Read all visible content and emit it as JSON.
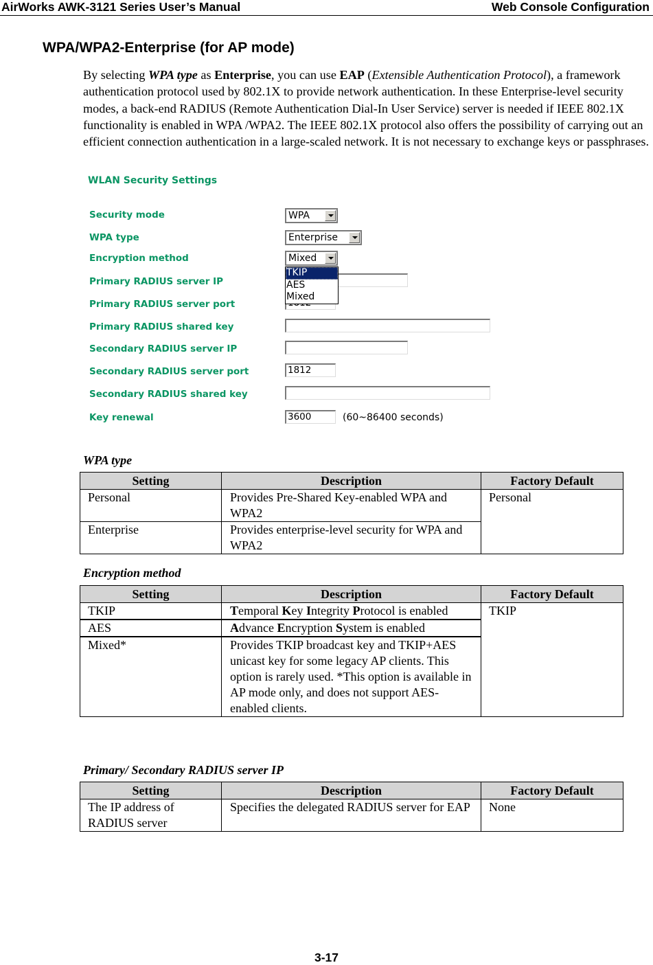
{
  "header": {
    "left": "AirWorks AWK-3121 Series User’s Manual",
    "right": "Web Console Configuration"
  },
  "section_title": "WPA/WPA2-Enterprise (for AP mode)",
  "intro": {
    "p1": "By selecting ",
    "b1": "WPA type",
    "p2": " as ",
    "b2": "Enterprise",
    "p3": ", you can use ",
    "b3": "EAP",
    "p4": " (",
    "i1": "Extensible Authentication Protocol",
    "p5": "), a framework authentication protocol used by 802.1X to provide network authentication. In these Enterprise-level security modes, a back-end RADIUS (Remote Authentication Dial-In User Service) server is needed if IEEE 802.1X functionality is enabled in WPA /WPA2. The IEEE 802.1X protocol also offers the possibility of carrying out an efficient connection authentication in a large-scaled network. It is not necessary to exchange keys or passphrases."
  },
  "web_ui": {
    "title": "WLAN Security Settings",
    "label_color": "#0a9563",
    "fields": {
      "security_mode": {
        "label": "Security mode",
        "value": "WPA"
      },
      "wpa_type": {
        "label": "WPA type",
        "value": "Enterprise"
      },
      "encryption_method": {
        "label": "Encryption method",
        "value": "Mixed",
        "options": [
          "TKIP",
          "AES",
          "Mixed"
        ],
        "highlighted": "TKIP"
      },
      "primary_ip": {
        "label": "Primary RADIUS server IP",
        "value": ""
      },
      "primary_port": {
        "label": "Primary RADIUS server port",
        "value": "1812"
      },
      "primary_key": {
        "label": "Primary RADIUS shared key",
        "value": ""
      },
      "secondary_ip": {
        "label": "Secondary RADIUS server IP",
        "value": ""
      },
      "secondary_port": {
        "label": "Secondary RADIUS server port",
        "value": "1812"
      },
      "secondary_key": {
        "label": "Secondary RADIUS shared key",
        "value": ""
      },
      "key_renewal": {
        "label": "Key renewal",
        "value": "3600",
        "hint": "(60~86400 seconds)"
      }
    }
  },
  "tables": {
    "headers": {
      "setting": "Setting",
      "description": "Description",
      "default": "Factory Default"
    },
    "wpa_type": {
      "caption": "WPA type",
      "rows": [
        {
          "setting": "Personal",
          "description": "Provides Pre-Shared Key-enabled WPA and WPA2"
        },
        {
          "setting": "Enterprise",
          "description": "Provides enterprise-level security for WPA and WPA2"
        }
      ],
      "default": "Personal"
    },
    "encryption": {
      "caption": "Encryption method",
      "rows": [
        {
          "setting": "TKIP",
          "d": [
            [
              "T",
              "emporal "
            ],
            [
              "K",
              "ey "
            ],
            [
              "I",
              "ntegrity "
            ],
            [
              "P",
              "rotocol is enabled"
            ]
          ]
        },
        {
          "setting": "AES",
          "d": [
            [
              "A",
              "dvance "
            ],
            [
              "E",
              "ncryption "
            ],
            [
              "S",
              "ystem is enabled"
            ]
          ]
        },
        {
          "setting": "Mixed*",
          "description": "Provides TKIP broadcast key and TKIP+AES unicast key for some legacy AP clients. This option is rarely used. *This option is available in AP mode only, and does not support AES-enabled clients."
        }
      ],
      "default": "TKIP"
    },
    "radius_ip": {
      "caption": "Primary/ Secondary RADIUS server IP",
      "rows": [
        {
          "setting": "The IP address of RADIUS server",
          "description": "Specifies the delegated RADIUS server for EAP"
        }
      ],
      "default": "None"
    }
  },
  "footer": {
    "page_number": "3-17"
  }
}
